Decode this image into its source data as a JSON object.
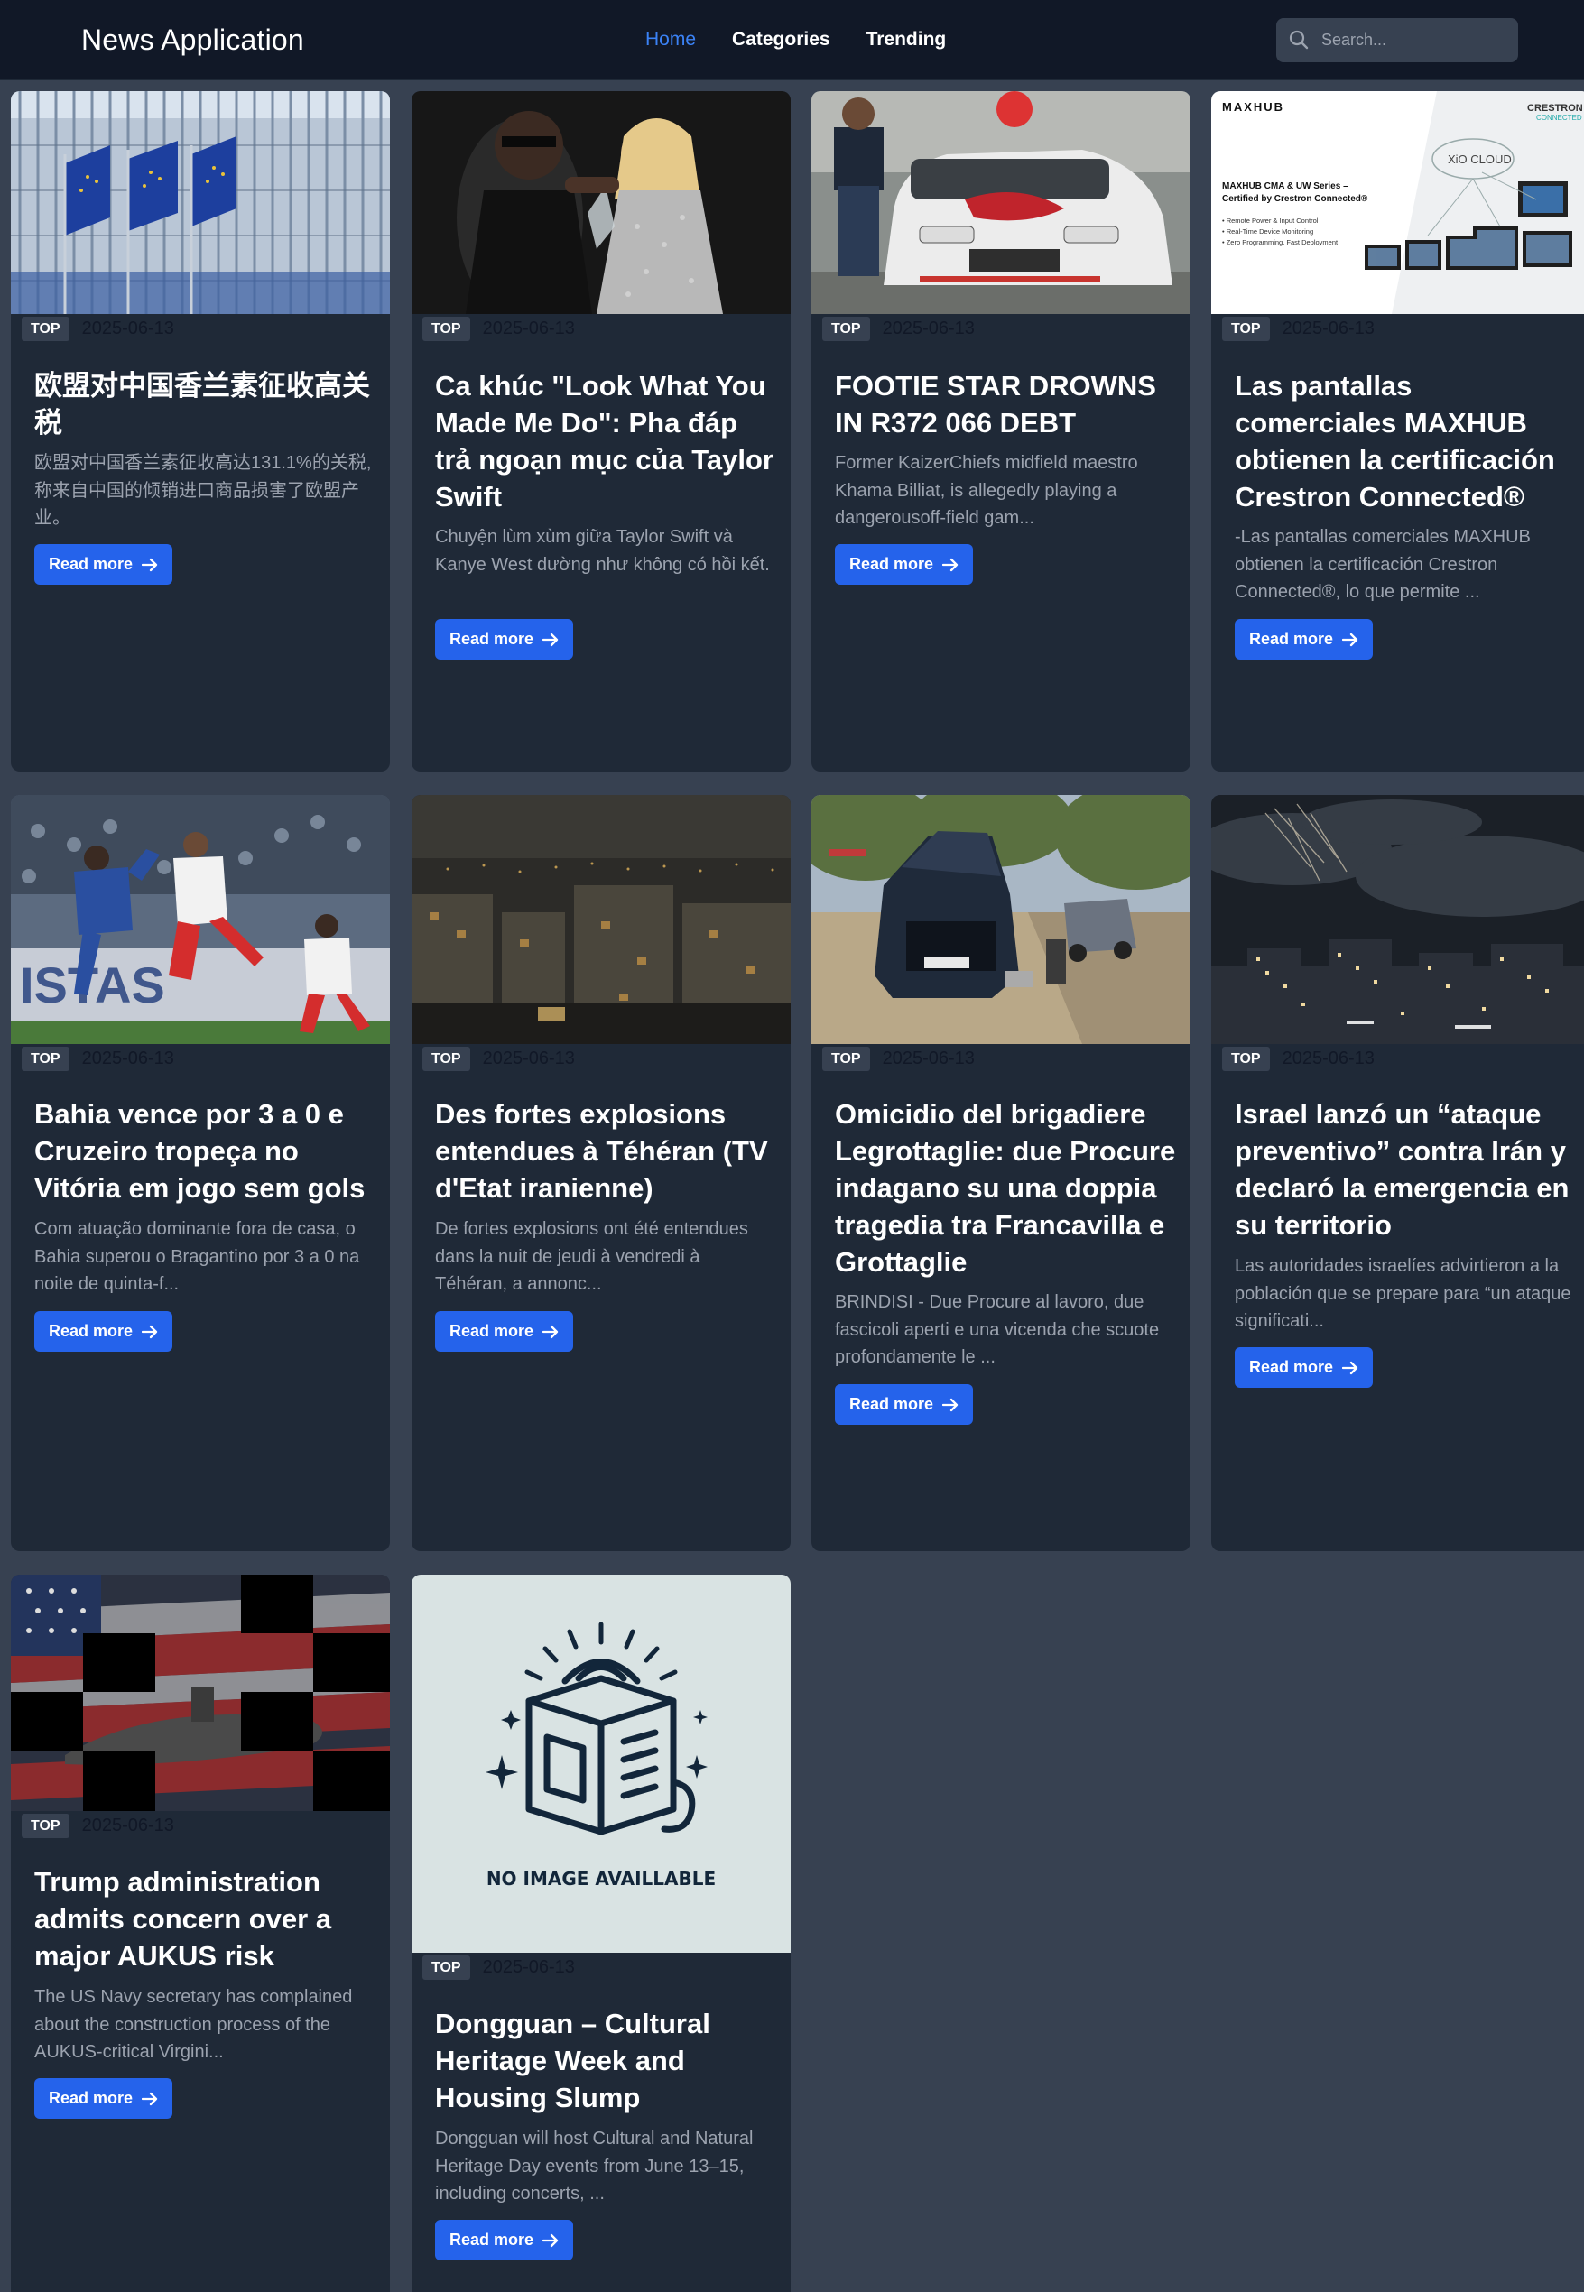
{
  "header": {
    "brand": "News Application",
    "nav": [
      "Home",
      "Categories",
      "Trending"
    ],
    "search_placeholder": "Search..."
  },
  "colors": {
    "header_bg": "#111827",
    "page_bg": "#374151",
    "card_bg": "#1f2937",
    "accent": "#2563eb",
    "nav_active": "#3b82f6"
  },
  "read_more_label": "Read more",
  "articles": [
    {
      "badge": "TOP",
      "date": "2025-06-13",
      "title": "欧盟对中国香兰素征收高关税",
      "description": "欧盟对中国香兰素征收高达131.1%的关税,称来自中国的倾销进口商品损害了欧盟产业。",
      "image": "eu-flags-photo"
    },
    {
      "badge": "TOP",
      "date": "2025-06-13",
      "title": "Ca khúc \"Look What You Made Me Do\": Pha đáp trả ngoạn mục của Taylor Swift",
      "description": "Chuyện lùm xùm giữa Taylor Swift và Kanye West dường như không có hồi kết.",
      "image": "stage-photo"
    },
    {
      "badge": "TOP",
      "date": "2025-06-13",
      "title": "FOOTIE STAR DROWNS IN R372 066 DEBT",
      "description": "Former KaizerChiefs midfield maestro Khama Billiat, is allegedly playing a dangerousoff-field gam...",
      "image": "car-photo"
    },
    {
      "badge": "TOP",
      "date": "2025-06-13",
      "title": "Las pantallas comerciales MAXHUB obtienen la certificación Crestron Connected®",
      "description": "-Las pantallas comerciales MAXHUB obtienen la certificación Crestron Connected®, lo que permite ...",
      "image": "maxhub-banner",
      "image_text": {
        "logo_left": "MAXHUB",
        "logo_right": "CRESTRON",
        "logo_right_sub": "CONNECTED",
        "cloud": "XiO CLOUD",
        "headline_1": "MAXHUB CMA & UW Series –",
        "headline_2": "Certified by Crestron Connected®",
        "bullets": [
          "• Remote Power & Input Control",
          "• Real-Time Device Monitoring",
          "• Zero Programming, Fast Deployment"
        ]
      }
    },
    {
      "badge": "TOP",
      "date": "2025-06-13",
      "title": "Bahia vence por 3 a 0 e Cruzeiro tropeça no Vitória em jogo sem gols",
      "description": "Com atuação dominante fora de casa, o Bahia superou o Bragantino por 3 a 0 na noite de quinta-f...",
      "image": "soccer-photo"
    },
    {
      "badge": "TOP",
      "date": "2025-06-13",
      "title": "Des fortes explosions entendues à Téhéran (TV d'Etat iranienne)",
      "description": "De fortes explosions ont été entendues dans la nuit de jeudi à vendredi à Téhéran, a annonc...",
      "image": "night-city-photo"
    },
    {
      "badge": "TOP",
      "date": "2025-06-13",
      "title": "Omicidio del brigadiere Legrottaglie: due Procure indagano su una doppia tragedia tra Francavilla e Grottaglie",
      "description": "BRINDISI - Due Procure al lavoro, due fascicoli aperti e una vicenda che scuote profondamente le ...",
      "image": "roadside-car-photo"
    },
    {
      "badge": "TOP",
      "date": "2025-06-13",
      "title": "Israel lanzó un “ataque preventivo” contra Irán y declaró la emergencia en su territorio",
      "description": "Las autoridades israelíes advirtieron a la población que se prepare para “un ataque significati...",
      "image": "night-sky-photo"
    },
    {
      "badge": "TOP",
      "date": "2025-06-13",
      "title": "Trump administration admits concern over a major AUKUS risk",
      "description": "The US Navy secretary has complained about the construction process of the AUKUS-critical Virgini...",
      "image": "flag-submarine-photo"
    },
    {
      "badge": "TOP",
      "date": "2025-06-13",
      "title": "Dongguan – Cultural Heritage Week and Housing Slump",
      "description": "Dongguan will host Cultural and Natural Heritage Day events from June 13–15, including concerts, ...",
      "image": "no-image-placeholder",
      "image_text": "NO IMAGE AVAILLABLE"
    }
  ]
}
